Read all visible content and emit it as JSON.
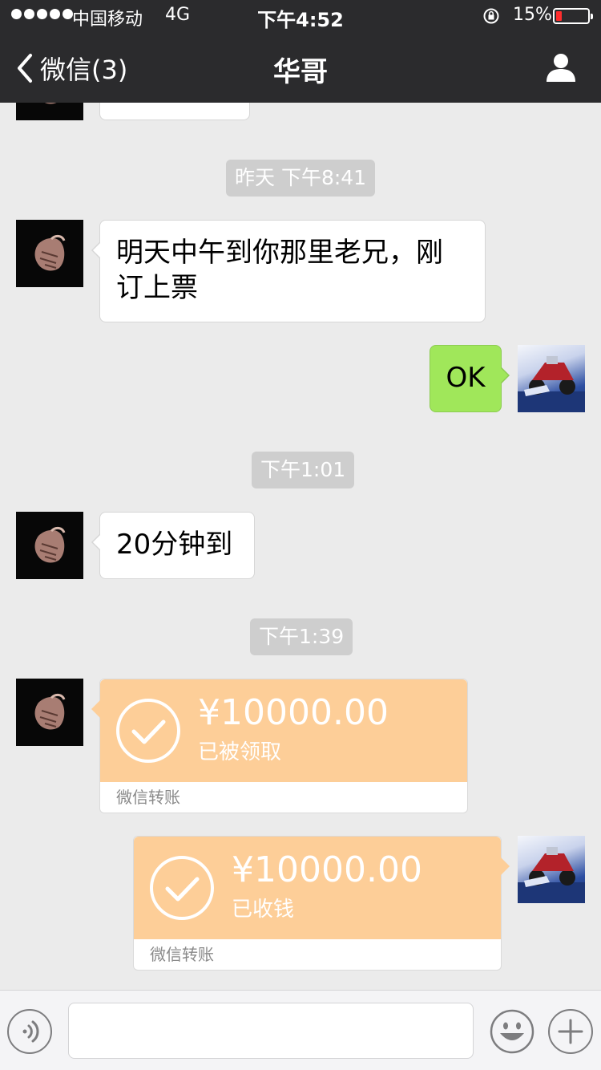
{
  "status_bar": {
    "carrier": "中国移动",
    "network": "4G",
    "time": "下午4:52",
    "battery_percent": "15%",
    "battery_level": 0.15
  },
  "nav": {
    "back_label": "微信(3)",
    "title": "华哥"
  },
  "messages": [
    {
      "type": "timestamp",
      "text": "昨天 下午8:41"
    },
    {
      "type": "text",
      "side": "left",
      "text_line1": "明天中午到你那里老兄，刚",
      "text_line2": "订上票"
    },
    {
      "type": "text",
      "side": "right",
      "text": "OK"
    },
    {
      "type": "timestamp",
      "text": "下午1:01"
    },
    {
      "type": "text",
      "side": "left",
      "text": "20分钟到"
    },
    {
      "type": "timestamp",
      "text": "下午1:39"
    },
    {
      "type": "transfer",
      "side": "left",
      "amount": "¥10000.00",
      "status": "已被领取",
      "footer": "微信转账"
    },
    {
      "type": "transfer",
      "side": "right",
      "amount": "¥10000.00",
      "status": "已收钱",
      "footer": "微信转账"
    }
  ],
  "icons": {
    "back": "chevron-left-icon",
    "profile": "person-icon",
    "voice": "voice-icon",
    "emoji": "emoji-icon",
    "plus": "plus-icon",
    "check": "check-circle-icon"
  },
  "input": {
    "placeholder": "",
    "value": ""
  },
  "colors": {
    "header_bg": "#2b2b2d",
    "chat_bg": "#ebebeb",
    "sent_bubble": "#a0e75a",
    "transfer_orange": "#fdce98",
    "battery_low": "#ff2d2d"
  }
}
